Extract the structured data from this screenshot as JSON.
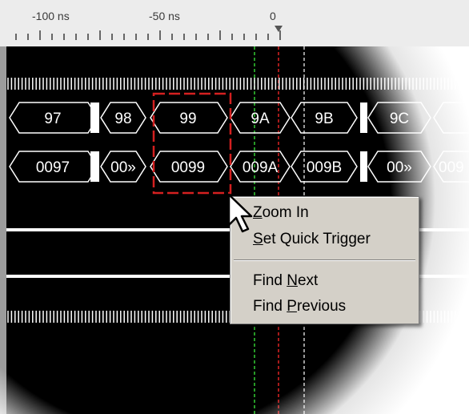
{
  "timeline": {
    "labels": [
      "-100 ns",
      "-50 ns",
      "0"
    ]
  },
  "bus1": {
    "values": [
      "97",
      "98",
      "99",
      "9A",
      "9B",
      "9C"
    ]
  },
  "bus2": {
    "values": [
      "0097",
      "00»",
      "0099",
      "009A",
      "009B",
      "00»",
      "009"
    ]
  },
  "context_menu": {
    "items": [
      {
        "label": "Zoom In",
        "mnemonic": "Z"
      },
      {
        "label": "Set Quick Trigger",
        "mnemonic": "S"
      },
      {
        "label": "Find Next",
        "mnemonic": "N"
      },
      {
        "label": "Find Previous",
        "mnemonic": "P"
      }
    ]
  },
  "colors": {
    "waveform_background": "#000000",
    "signal": "#ffffff",
    "selection_box": "#d42020",
    "cursor_green": "#33cc33",
    "cursor_red": "#dd2222",
    "menu_background": "#d4d0c8"
  }
}
